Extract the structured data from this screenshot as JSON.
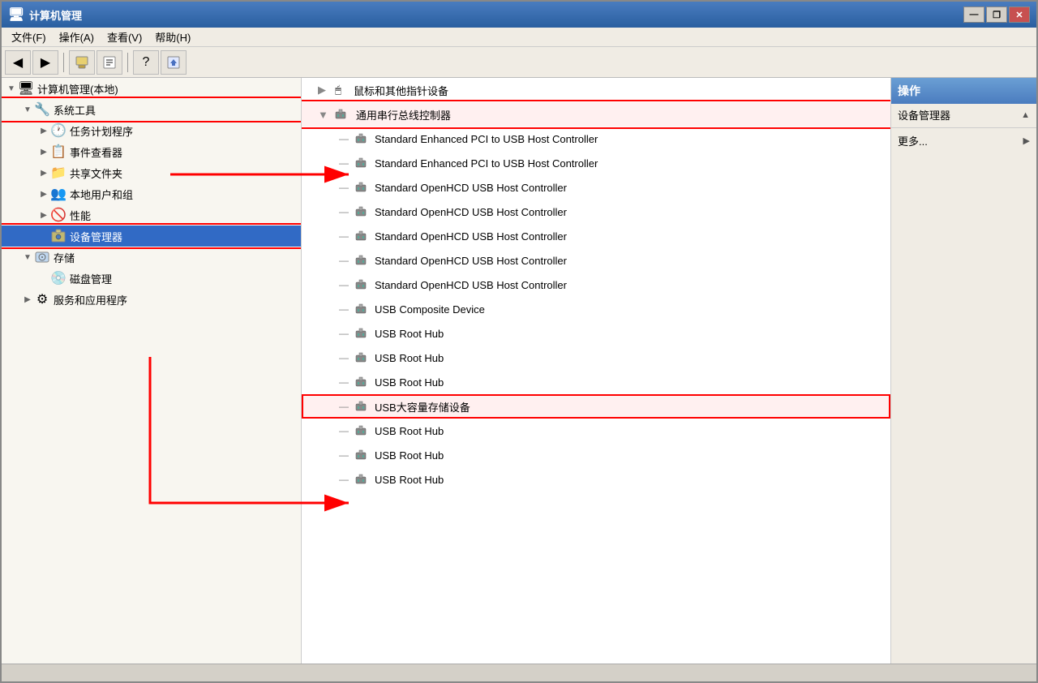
{
  "window": {
    "title": "计算机管理",
    "titleIcon": "🖥"
  },
  "titleBtns": {
    "minimize": "—",
    "restore": "❐",
    "close": "✕"
  },
  "menu": {
    "items": [
      "文件(F)",
      "操作(A)",
      "查看(V)",
      "帮助(H)"
    ]
  },
  "sidebar": {
    "rootLabel": "计算机管理(本地)",
    "items": [
      {
        "id": "system-tools",
        "label": "系统工具",
        "icon": "🔧",
        "level": 1,
        "expanded": true,
        "highlighted": true
      },
      {
        "id": "task-scheduler",
        "label": "任务计划程序",
        "icon": "🕐",
        "level": 2,
        "expanded": false
      },
      {
        "id": "event-viewer",
        "label": "事件查看器",
        "icon": "📋",
        "level": 2,
        "expanded": false
      },
      {
        "id": "shared-folders",
        "label": "共享文件夹",
        "icon": "📁",
        "level": 2,
        "expanded": false
      },
      {
        "id": "local-users",
        "label": "本地用户和组",
        "icon": "👥",
        "level": 2,
        "expanded": false
      },
      {
        "id": "performance",
        "label": "性能",
        "icon": "🚫",
        "level": 2,
        "expanded": false
      },
      {
        "id": "device-manager",
        "label": "设备管理器",
        "icon": "🖥",
        "level": 2,
        "expanded": false,
        "highlighted": true,
        "selected": true
      },
      {
        "id": "storage",
        "label": "存储",
        "icon": "💾",
        "level": 1,
        "expanded": true
      },
      {
        "id": "disk-management",
        "label": "磁盘管理",
        "icon": "💿",
        "level": 2
      },
      {
        "id": "services",
        "label": "服务和应用程序",
        "icon": "⚙",
        "level": 1,
        "expanded": false
      }
    ]
  },
  "centerPanel": {
    "categoryLabel": "鼠标和其他指针设备",
    "usbControllerLabel": "通用串行总线控制器",
    "devices": [
      {
        "id": "d1",
        "label": "Standard Enhanced PCI to USB Host Controller",
        "type": "usb"
      },
      {
        "id": "d2",
        "label": "Standard Enhanced PCI to USB Host Controller",
        "type": "usb"
      },
      {
        "id": "d3",
        "label": "Standard OpenHCD USB Host Controller",
        "type": "usb"
      },
      {
        "id": "d4",
        "label": "Standard OpenHCD USB Host Controller",
        "type": "usb"
      },
      {
        "id": "d5",
        "label": "Standard OpenHCD USB Host Controller",
        "type": "usb"
      },
      {
        "id": "d6",
        "label": "Standard OpenHCD USB Host Controller",
        "type": "usb"
      },
      {
        "id": "d7",
        "label": "Standard OpenHCD USB Host Controller",
        "type": "usb"
      },
      {
        "id": "d8",
        "label": "USB Composite Device",
        "type": "usb"
      },
      {
        "id": "d9",
        "label": "USB Root Hub",
        "type": "usb"
      },
      {
        "id": "d10",
        "label": "USB Root Hub",
        "type": "usb"
      },
      {
        "id": "d11",
        "label": "USB Root Hub",
        "type": "usb"
      },
      {
        "id": "d12",
        "label": "USB大容量存储设备",
        "type": "usb",
        "highlighted": true
      },
      {
        "id": "d13",
        "label": "USB Root Hub",
        "type": "usb"
      },
      {
        "id": "d14",
        "label": "USB Root Hub",
        "type": "usb"
      },
      {
        "id": "d15",
        "label": "USB Root Hub",
        "type": "usb"
      }
    ]
  },
  "rightPanel": {
    "header": "操作",
    "actions": [
      {
        "id": "device-manager-action",
        "label": "设备管理器",
        "hasArrow": true
      },
      {
        "id": "more",
        "label": "更多...",
        "hasArrow": true
      }
    ]
  },
  "statusBar": {
    "text": ""
  }
}
